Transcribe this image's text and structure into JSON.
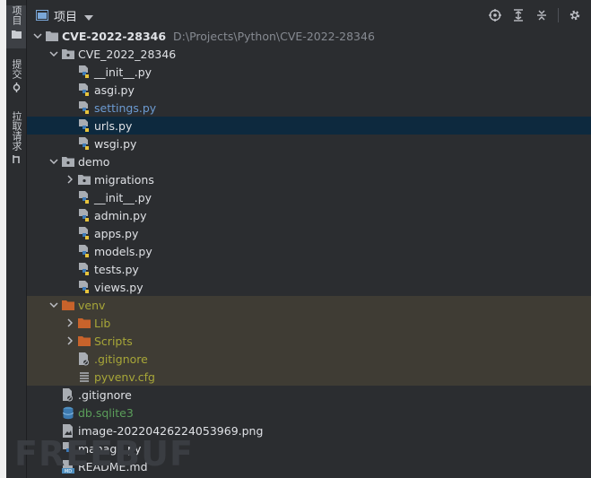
{
  "side_tabs": [
    {
      "label": "项目",
      "icon": "folder-icon",
      "active": true
    },
    {
      "label": "提交",
      "icon": "commit-icon",
      "active": false
    },
    {
      "label": "拉取请求",
      "icon": "pull-request-icon",
      "active": false
    }
  ],
  "header": {
    "title": "项目"
  },
  "toolbar": [
    "locate-icon",
    "expand-all-icon",
    "collapse-all-icon",
    "settings-icon"
  ],
  "tree": [
    {
      "name": "CVE-2022-28346",
      "path": "D:\\Projects\\Python\\CVE-2022-28346",
      "type": "project-folder",
      "depth": 0,
      "expanded": true,
      "bold": true
    },
    {
      "name": "CVE_2022_28346",
      "type": "package-folder",
      "depth": 1,
      "expanded": true
    },
    {
      "name": "__init__.py",
      "type": "python",
      "depth": 2
    },
    {
      "name": "asgi.py",
      "type": "python",
      "depth": 2
    },
    {
      "name": "settings.py",
      "type": "python",
      "depth": 2,
      "status": "modified"
    },
    {
      "name": "urls.py",
      "type": "python",
      "depth": 2,
      "selected": true
    },
    {
      "name": "wsgi.py",
      "type": "python",
      "depth": 2
    },
    {
      "name": "demo",
      "type": "package-folder",
      "depth": 1,
      "expanded": true
    },
    {
      "name": "migrations",
      "type": "package-folder",
      "depth": 2,
      "expanded": false
    },
    {
      "name": "__init__.py",
      "type": "python",
      "depth": 2
    },
    {
      "name": "admin.py",
      "type": "python",
      "depth": 2
    },
    {
      "name": "apps.py",
      "type": "python",
      "depth": 2
    },
    {
      "name": "models.py",
      "type": "python",
      "depth": 2
    },
    {
      "name": "tests.py",
      "type": "python",
      "depth": 2
    },
    {
      "name": "views.py",
      "type": "python",
      "depth": 2
    },
    {
      "name": "venv",
      "type": "excluded-folder",
      "depth": 1,
      "expanded": true,
      "status": "ignored"
    },
    {
      "name": "Lib",
      "type": "excluded-folder",
      "depth": 2,
      "expanded": false,
      "status": "ignored"
    },
    {
      "name": "Scripts",
      "type": "excluded-folder",
      "depth": 2,
      "expanded": false,
      "status": "ignored"
    },
    {
      "name": ".gitignore",
      "type": "gitignore",
      "depth": 2,
      "status": "ignored"
    },
    {
      "name": "pyvenv.cfg",
      "type": "config",
      "depth": 2,
      "status": "ignored"
    },
    {
      "name": ".gitignore",
      "type": "gitignore",
      "depth": 1
    },
    {
      "name": "db.sqlite3",
      "type": "database",
      "depth": 1,
      "status": "db"
    },
    {
      "name": "image-20220426224053969.png",
      "type": "image",
      "depth": 1
    },
    {
      "name": "manage.py",
      "type": "python",
      "depth": 1
    },
    {
      "name": "README.md",
      "type": "markdown",
      "depth": 1
    }
  ],
  "colors": {
    "background": "#2b2d30",
    "selected_row": "#0d293e",
    "excluded_row": "#3f3c34",
    "modified_text": "#6c9bd2",
    "ignored_text": "#a7a638",
    "folder_excluded": "#c8632b",
    "folder_normal": "#a9adb3"
  }
}
